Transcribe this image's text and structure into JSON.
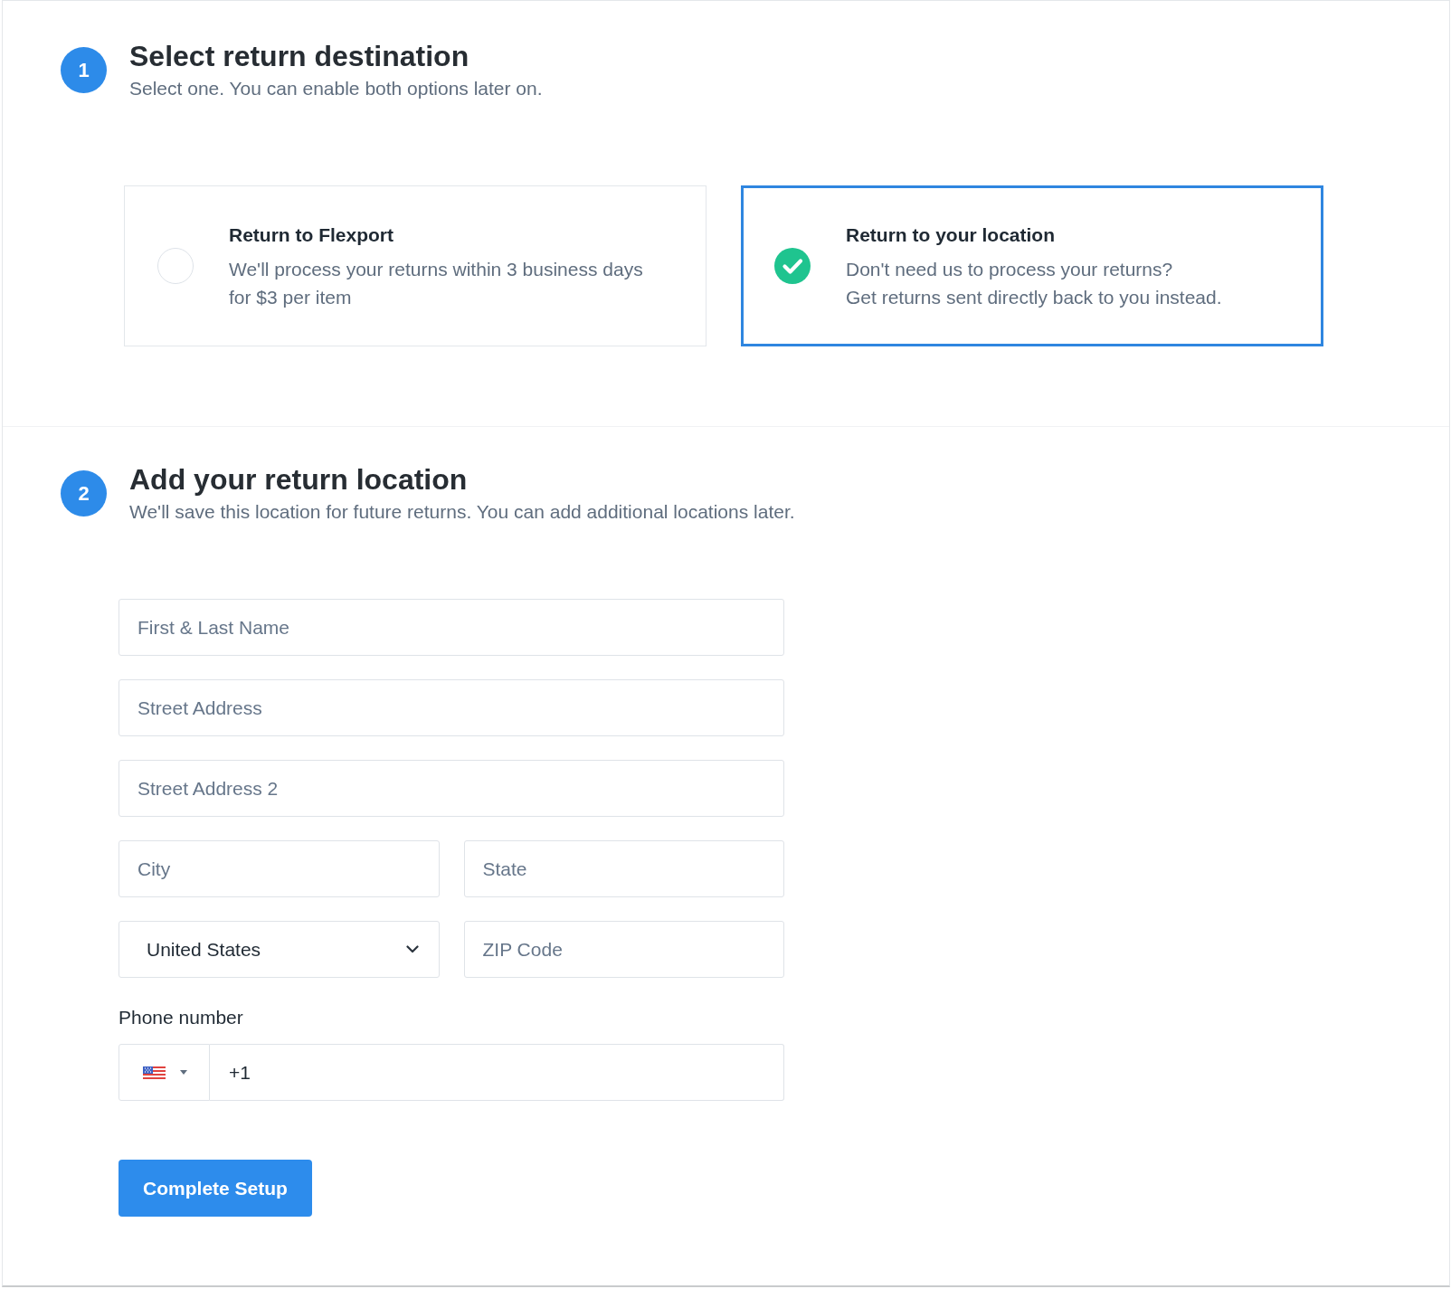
{
  "steps": [
    {
      "number": "1",
      "title": "Select return destination",
      "subtitle": "Select one. You can enable both options later on.",
      "options": [
        {
          "title": "Return to Flexport",
          "description": [
            "We'll process your returns within 3 business days",
            "for $3 per item"
          ],
          "selected": false
        },
        {
          "title": "Return to your location",
          "description": [
            "Don't need us to process your returns?",
            "Get returns sent directly back to you instead."
          ],
          "selected": true
        }
      ]
    },
    {
      "number": "2",
      "title": "Add your return location",
      "subtitle": "We'll save this location for future returns. You can add additional locations later.",
      "form": {
        "rows": [
          [
            {
              "kind": "text",
              "placeholder": "First & Last Name"
            }
          ],
          [
            {
              "kind": "text",
              "placeholder": "Street Address"
            }
          ],
          [
            {
              "kind": "text",
              "placeholder": "Street Address 2"
            }
          ],
          [
            {
              "kind": "text",
              "placeholder": "City"
            },
            {
              "kind": "text",
              "placeholder": "State"
            }
          ],
          [
            {
              "kind": "select",
              "value": "United States"
            },
            {
              "kind": "text",
              "placeholder": "ZIP Code"
            }
          ]
        ],
        "phone": {
          "label": "Phone number",
          "value": "+1"
        },
        "submit": {
          "label": "Complete Setup"
        }
      }
    }
  ]
}
